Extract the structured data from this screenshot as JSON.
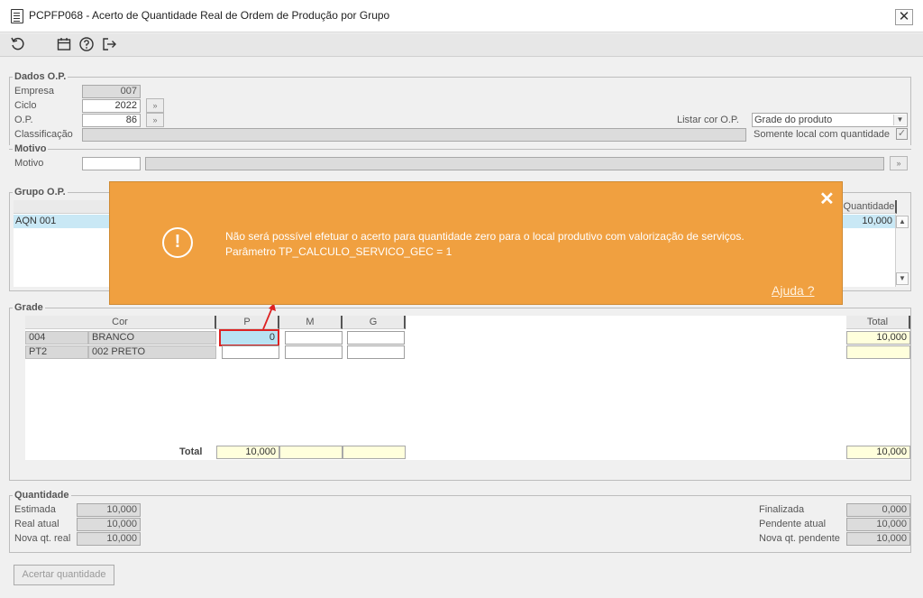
{
  "window": {
    "title": "PCPFP068 - Acerto de Quantidade Real de Ordem de Produção por Grupo",
    "close_glyph": "✕"
  },
  "toolbar": {
    "icons": [
      "refresh-icon",
      "calendar-icon",
      "help-icon",
      "exit-icon"
    ]
  },
  "dados_op": {
    "legend": "Dados O.P.",
    "empresa_label": "Empresa",
    "empresa_value": "007",
    "ciclo_label": "Ciclo",
    "ciclo_value": "2022",
    "op_label": "O.P.",
    "op_value": "86",
    "classificacao_label": "Classificação",
    "listar_cor_label": "Listar cor O.P.",
    "listar_cor_value": "Grade do produto",
    "somente_local_label": "Somente local com quantidade"
  },
  "motivo": {
    "legend": "Motivo",
    "label": "Motivo",
    "value": ""
  },
  "grupo_op": {
    "legend": "Grupo O.P.",
    "col_quantidade": "Quantidade",
    "rows": [
      {
        "grupo": "AQN 001",
        "quantidade": "10,000"
      }
    ]
  },
  "toast": {
    "message": "Não será possível efetuar o acerto para quantidade zero para o local produtivo com valorização de serviços. Parâmetro TP_CALCULO_SERVICO_GEC  = 1",
    "help": "Ajuda ?",
    "close_glyph": "✕",
    "icon_glyph": "!"
  },
  "grade": {
    "legend": "Grade",
    "col_cor": "Cor",
    "col_p": "P",
    "col_m": "M",
    "col_g": "G",
    "col_total": "Total",
    "rows": [
      {
        "code": "004",
        "name": "BRANCO",
        "p": "0",
        "m": "",
        "g": "",
        "total": "10,000"
      },
      {
        "code": "PT2",
        "name": "002 PRETO",
        "p": "",
        "m": "",
        "g": "",
        "total": ""
      }
    ],
    "total_label": "Total",
    "total_p": "10,000",
    "total_m": "",
    "total_g": "",
    "total_total": "10,000"
  },
  "quantidade": {
    "legend": "Quantidade",
    "estimada_label": "Estimada",
    "estimada_value": "10,000",
    "real_atual_label": "Real atual",
    "real_atual_value": "10,000",
    "nova_real_label": "Nova qt. real",
    "nova_real_value": "10,000",
    "finalizada_label": "Finalizada",
    "finalizada_value": "0,000",
    "pendente_label": "Pendente atual",
    "pendente_value": "10,000",
    "nova_pendente_label": "Nova qt. pendente",
    "nova_pendente_value": "10,000"
  },
  "actions": {
    "acertar_label": "Acertar quantidade"
  },
  "colors": {
    "toast": "#f0a040",
    "highlight_cell": "#b8e2f2",
    "highlight_border": "#d22",
    "total_yellow": "#ffffdc"
  }
}
